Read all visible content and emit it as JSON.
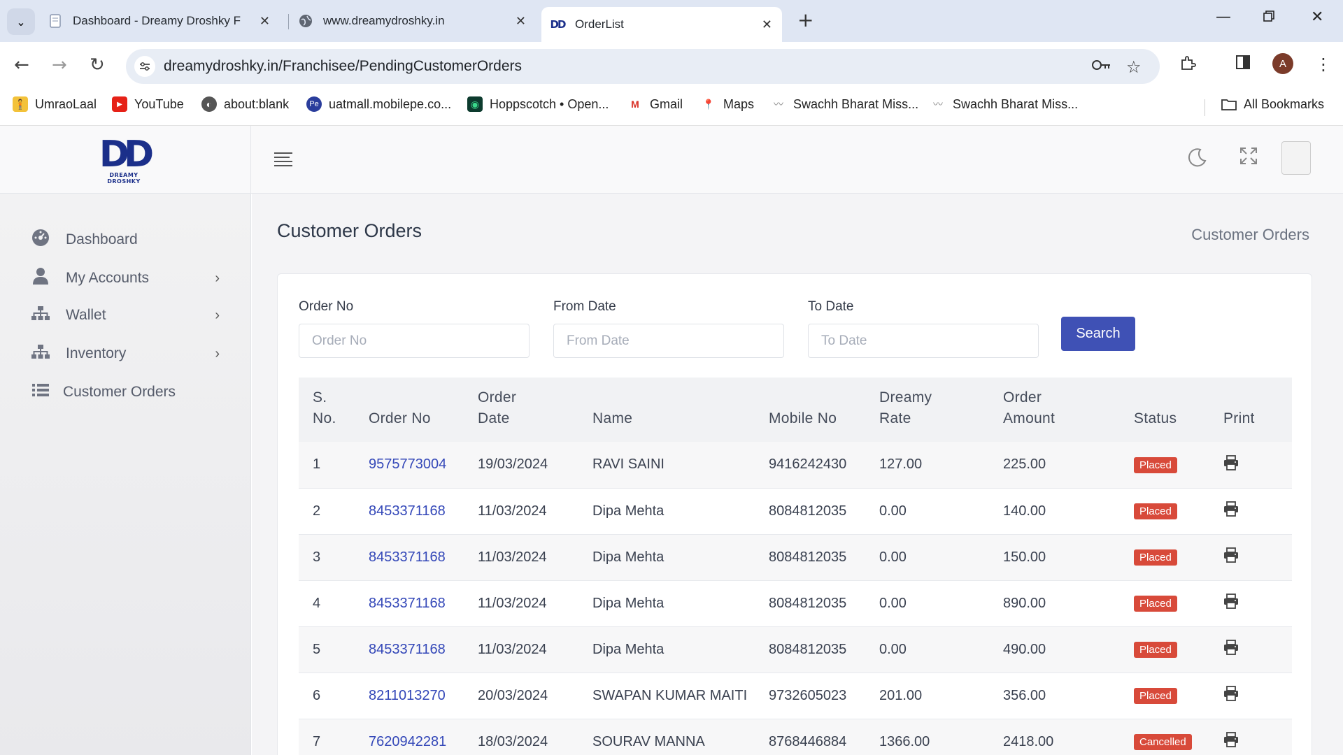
{
  "browser": {
    "tabs": [
      {
        "title": "Dashboard - Dreamy Droshky F",
        "active": false
      },
      {
        "title": "www.dreamydroshky.in",
        "active": false
      },
      {
        "title": "OrderList",
        "active": true
      }
    ],
    "url": "dreamydroshky.in/Franchisee/PendingCustomerOrders",
    "profile_initial": "A",
    "bookmarks": [
      "UmraoLaal",
      "YouTube",
      "about:blank",
      "uatmall.mobilepe.co...",
      "Hoppscotch • Open...",
      "Gmail",
      "Maps",
      "Swachh Bharat Miss...",
      "Swachh Bharat Miss..."
    ],
    "all_bookmarks": "All Bookmarks"
  },
  "app": {
    "logo_text": "DD",
    "logo_subtext": "DREAMY DROSHKY",
    "sidebar": [
      {
        "label": "Dashboard",
        "icon": "dashboard-icon",
        "has_submenu": false
      },
      {
        "label": "My Accounts",
        "icon": "user-icon",
        "has_submenu": true
      },
      {
        "label": "Wallet",
        "icon": "sitemap-icon",
        "has_submenu": true
      },
      {
        "label": "Inventory",
        "icon": "sitemap-icon",
        "has_submenu": true
      },
      {
        "label": "Customer Orders",
        "icon": "list-icon",
        "has_submenu": false
      }
    ],
    "page_title": "Customer Orders",
    "breadcrumb": "Customer Orders",
    "filters": {
      "order_no_label": "Order No",
      "order_no_placeholder": "Order No",
      "from_date_label": "From Date",
      "from_date_placeholder": "From Date",
      "to_date_label": "To Date",
      "to_date_placeholder": "To Date",
      "search_label": "Search"
    },
    "table": {
      "headers": [
        {
          "l1": "S.",
          "l2": "No."
        },
        {
          "l1": "",
          "l2": "Order No"
        },
        {
          "l1": "Order",
          "l2": "Date"
        },
        {
          "l1": "",
          "l2": "Name"
        },
        {
          "l1": "",
          "l2": "Mobile No"
        },
        {
          "l1": "Dreamy",
          "l2": "Rate"
        },
        {
          "l1": "Order",
          "l2": "Amount"
        },
        {
          "l1": "",
          "l2": "Status"
        },
        {
          "l1": "",
          "l2": "Print"
        }
      ],
      "rows": [
        {
          "sn": "1",
          "order_no": "9575773004",
          "date": "19/03/2024",
          "name": "RAVI SAINI",
          "mobile": "9416242430",
          "rate": "127.00",
          "amount": "225.00",
          "status": "Placed"
        },
        {
          "sn": "2",
          "order_no": "8453371168",
          "date": "11/03/2024",
          "name": "Dipa Mehta",
          "mobile": "8084812035",
          "rate": "0.00",
          "amount": "140.00",
          "status": "Placed"
        },
        {
          "sn": "3",
          "order_no": "8453371168",
          "date": "11/03/2024",
          "name": "Dipa Mehta",
          "mobile": "8084812035",
          "rate": "0.00",
          "amount": "150.00",
          "status": "Placed"
        },
        {
          "sn": "4",
          "order_no": "8453371168",
          "date": "11/03/2024",
          "name": "Dipa Mehta",
          "mobile": "8084812035",
          "rate": "0.00",
          "amount": "890.00",
          "status": "Placed"
        },
        {
          "sn": "5",
          "order_no": "8453371168",
          "date": "11/03/2024",
          "name": "Dipa Mehta",
          "mobile": "8084812035",
          "rate": "0.00",
          "amount": "490.00",
          "status": "Placed"
        },
        {
          "sn": "6",
          "order_no": "8211013270",
          "date": "20/03/2024",
          "name": "SWAPAN KUMAR MAITI",
          "mobile": "9732605023",
          "rate": "201.00",
          "amount": "356.00",
          "status": "Placed"
        },
        {
          "sn": "7",
          "order_no": "7620942281",
          "date": "18/03/2024",
          "name": "SOURAV MANNA",
          "mobile": "8768446884",
          "rate": "1366.00",
          "amount": "2418.00",
          "status": "Cancelled"
        }
      ]
    }
  },
  "colors": {
    "brand": "#1b2f8a",
    "primary": "#3f51b5",
    "danger": "#d84a3a",
    "link": "#3347b8"
  }
}
